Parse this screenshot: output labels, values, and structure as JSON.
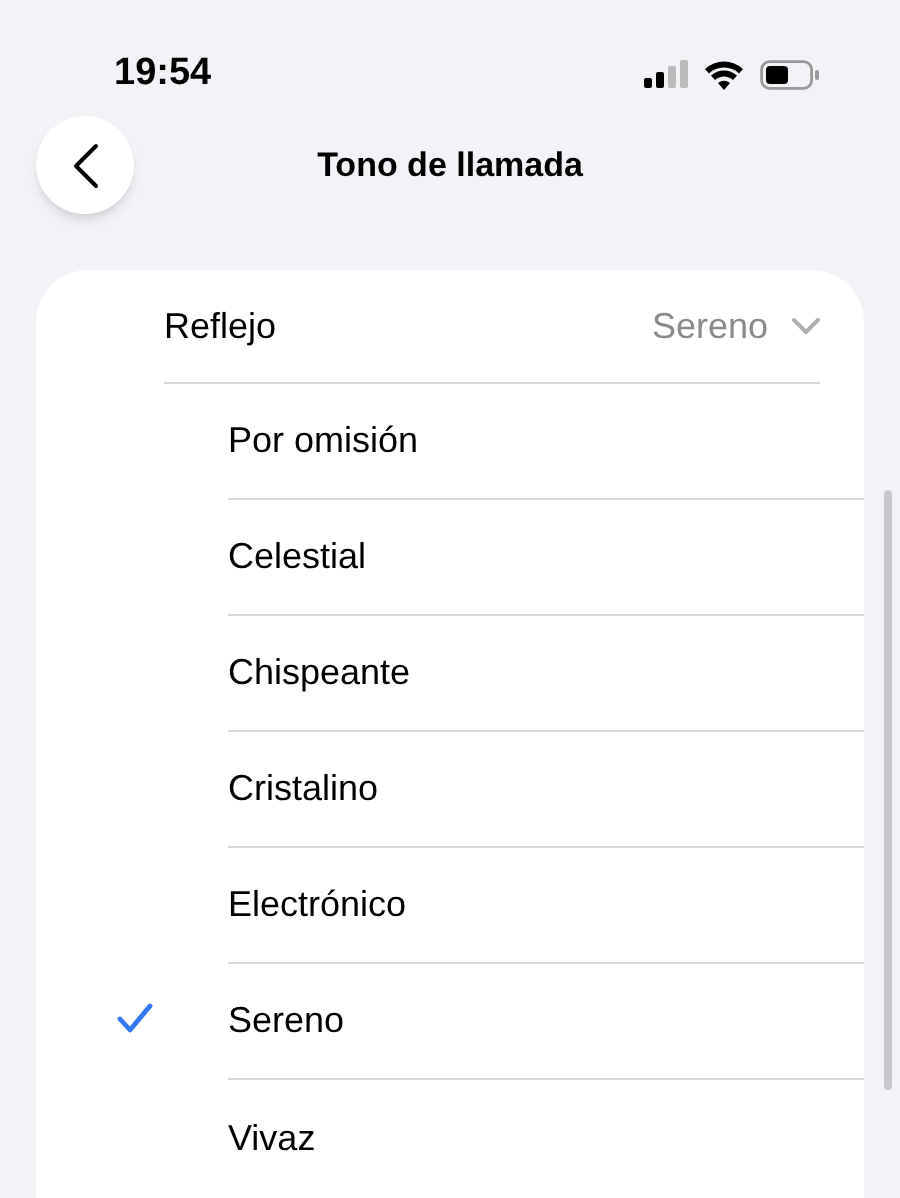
{
  "status_bar": {
    "time": "19:54"
  },
  "nav": {
    "title": "Tono de llamada"
  },
  "picker": {
    "label": "Reflejo",
    "value": "Sereno"
  },
  "options": [
    {
      "label": "Por omisión",
      "selected": false
    },
    {
      "label": "Celestial",
      "selected": false
    },
    {
      "label": "Chispeante",
      "selected": false
    },
    {
      "label": "Cristalino",
      "selected": false
    },
    {
      "label": "Electrónico",
      "selected": false
    },
    {
      "label": "Sereno",
      "selected": true
    },
    {
      "label": "Vivaz",
      "selected": false
    }
  ]
}
